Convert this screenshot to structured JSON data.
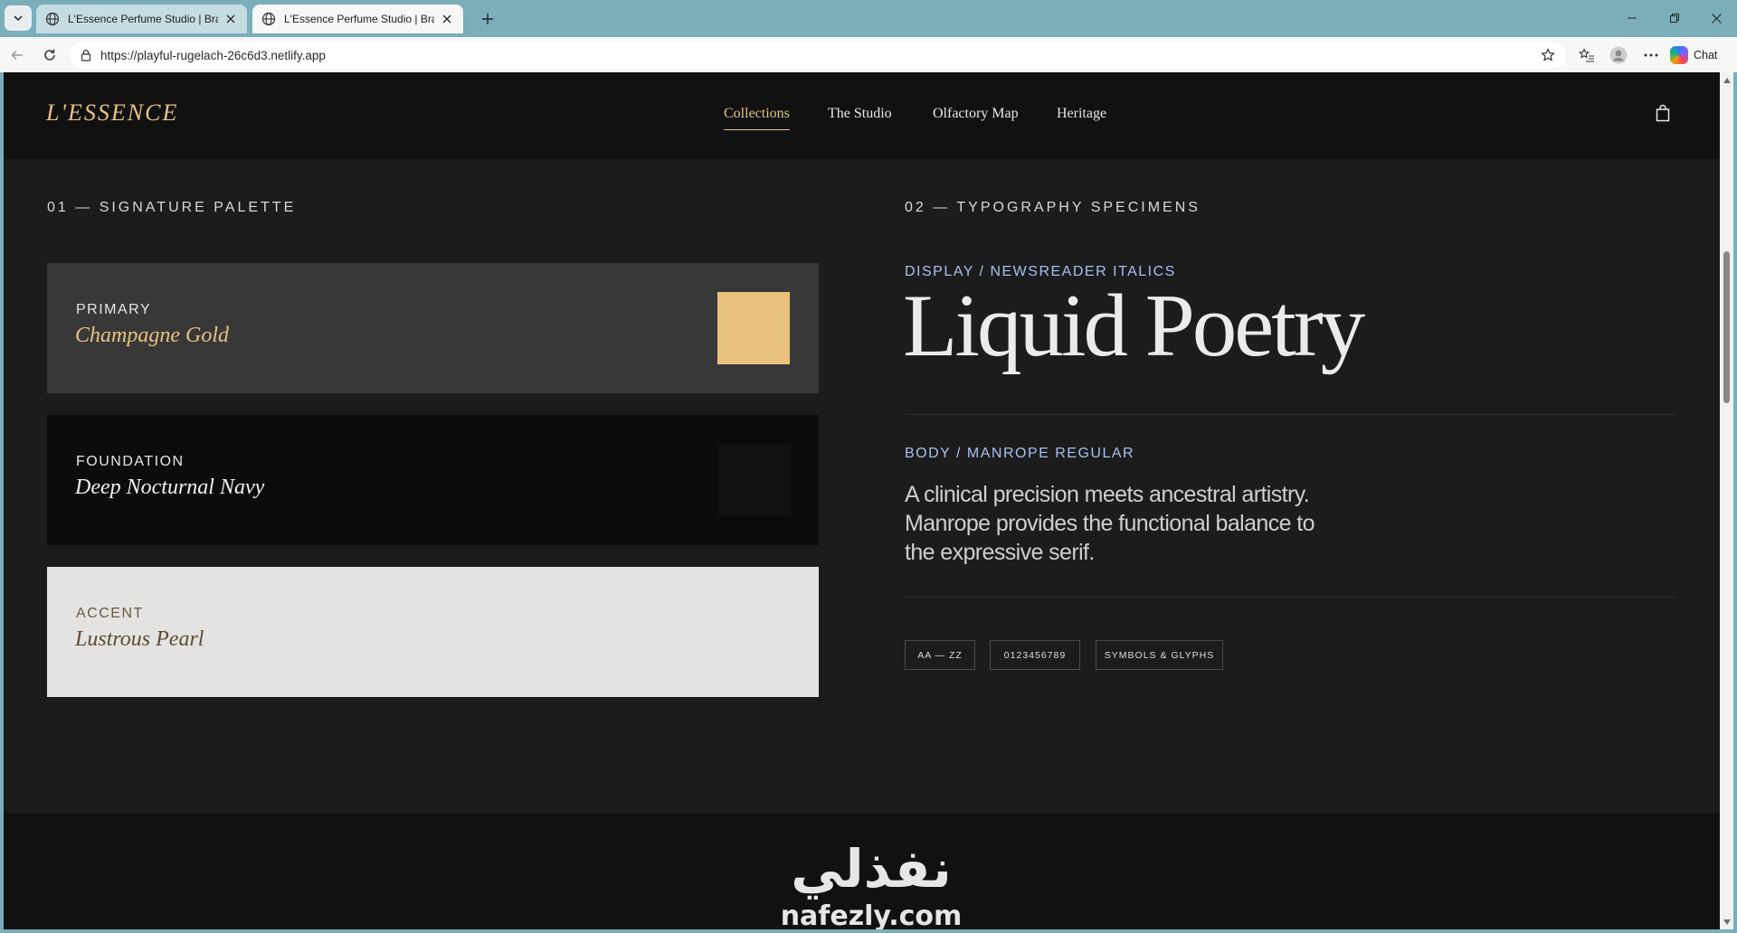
{
  "browser": {
    "tabs": [
      {
        "title": "L'Essence Perfume Studio | Brand I"
      },
      {
        "title": "L'Essence Perfume Studio | Brand I"
      }
    ],
    "url": "https://playful-rugelach-26c6d3.netlify.app",
    "copilot_label": "Chat",
    "icons": {
      "tab_menu": "chevron-down-icon",
      "favicon": "globe-icon",
      "close": "close-icon",
      "new_tab": "plus-icon",
      "back": "back-arrow-icon",
      "reload": "reload-icon",
      "site_info": "lock-icon",
      "favorite": "star-icon",
      "favorites": "favorites-list-icon",
      "profile": "profile-icon",
      "more": "more-icon"
    }
  },
  "site": {
    "brand": "L'ESSENCE",
    "nav": [
      {
        "label": "Collections",
        "active": true
      },
      {
        "label": "The Studio",
        "active": false
      },
      {
        "label": "Olfactory Map",
        "active": false
      },
      {
        "label": "Heritage",
        "active": false
      }
    ],
    "bag_icon": "shopping-bag-icon"
  },
  "palette": {
    "section_title": "01 — SIGNATURE PALETTE",
    "swatches": [
      {
        "label": "PRIMARY",
        "name": "Champagne Gold",
        "color": "#e9c27e",
        "card_bg": "#383838"
      },
      {
        "label": "FOUNDATION",
        "name": "Deep Nocturnal Navy",
        "color": "#111111",
        "card_bg": "#0c0c0c"
      },
      {
        "label": "ACCENT",
        "name": "Lustrous Pearl",
        "color": "#e5e3e1",
        "card_bg": "#e5e3e1"
      }
    ]
  },
  "typography": {
    "section_title": "02 — TYPOGRAPHY SPECIMENS",
    "display_label": "DISPLAY / NEWSREADER ITALICS",
    "display_sample": "Liquid Poetry",
    "body_label": "BODY / MANROPE REGULAR",
    "body_sample": "A clinical precision meets ancestral artistry. Manrope provides the functional balance to the expressive serif.",
    "chips": [
      "AA — ZZ",
      "0123456789",
      "SYMBOLS & GLYPHS"
    ]
  },
  "watermark": {
    "arabic": "نفذلي",
    "latin": "nafezly.com"
  },
  "colors": {
    "accent_gold": "#e9c27e",
    "spec_blue": "#a6c1f3",
    "page_bg": "#1c1c1c",
    "header_bg": "#111111"
  }
}
